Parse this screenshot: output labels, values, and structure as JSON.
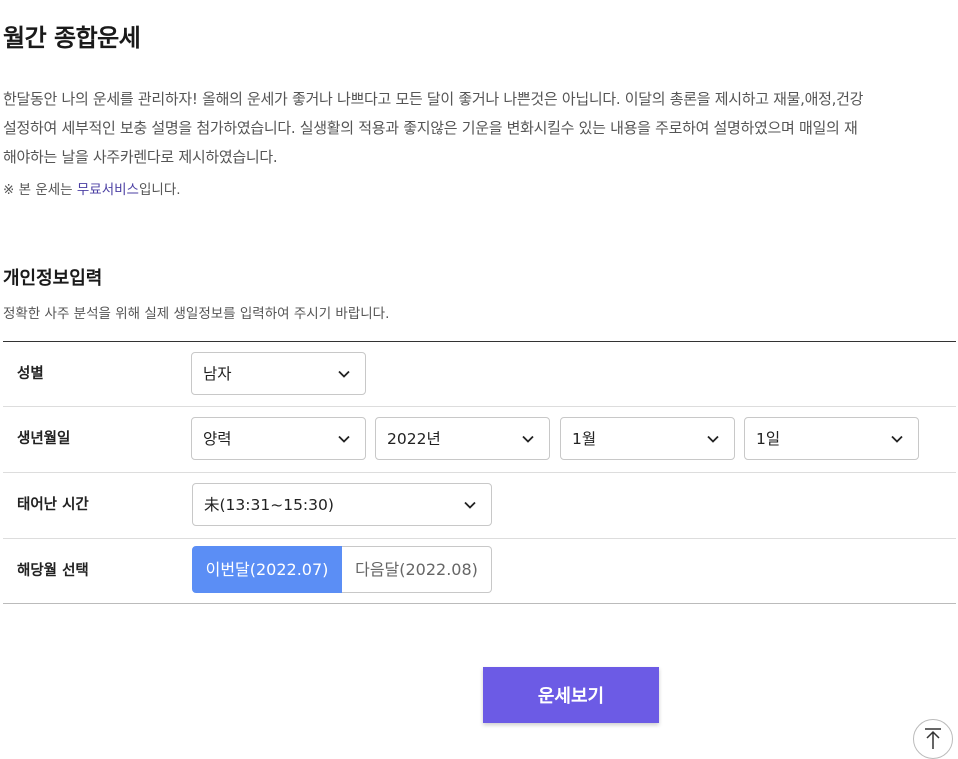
{
  "page": {
    "title": "월간 종합운세",
    "description_lines": [
      "한달동안 나의 운세를 관리하자! 올해의 운세가 좋거나 나쁘다고 모든 달이 좋거나 나쁜것은 아닙니다. 이달의 총론을 제시하고 재물,애정,건강",
      "설정하여 세부적인 보충 설명을 첨가하였습니다. 실생활의 적용과 좋지않은 기운을 변화시킬수 있는 내용을 주로하여 설명하였으며 매일의 재",
      "해야하는 날을 사주카렌다로 제시하였습니다."
    ],
    "note_prefix": "※ 본 운세는 ",
    "note_link": "무료서비스",
    "note_suffix": "입니다."
  },
  "section": {
    "title": "개인정보입력",
    "subtitle": "정확한 사주 분석을 위해 실제 생일정보를 입력하여 주시기 바랍니다."
  },
  "form": {
    "gender": {
      "label": "성별",
      "value": "남자"
    },
    "birth": {
      "label": "생년월일",
      "calendar": "양력",
      "year": "2022년",
      "month": "1월",
      "day": "1일"
    },
    "time": {
      "label": "태어난 시간",
      "value": "未(13:31~15:30)"
    },
    "month_select": {
      "label": "해당월 선택",
      "this_month": "이번달(2022.07)",
      "next_month": "다음달(2022.08)"
    }
  },
  "actions": {
    "submit_label": "운세보기"
  },
  "icons": {
    "dropdown": "chevron-down-icon",
    "scroll_top": "arrow-up-icon"
  },
  "colors": {
    "accent": "#6c5be5",
    "active_tab": "#5b8ef5",
    "link": "#4b3fa3"
  }
}
